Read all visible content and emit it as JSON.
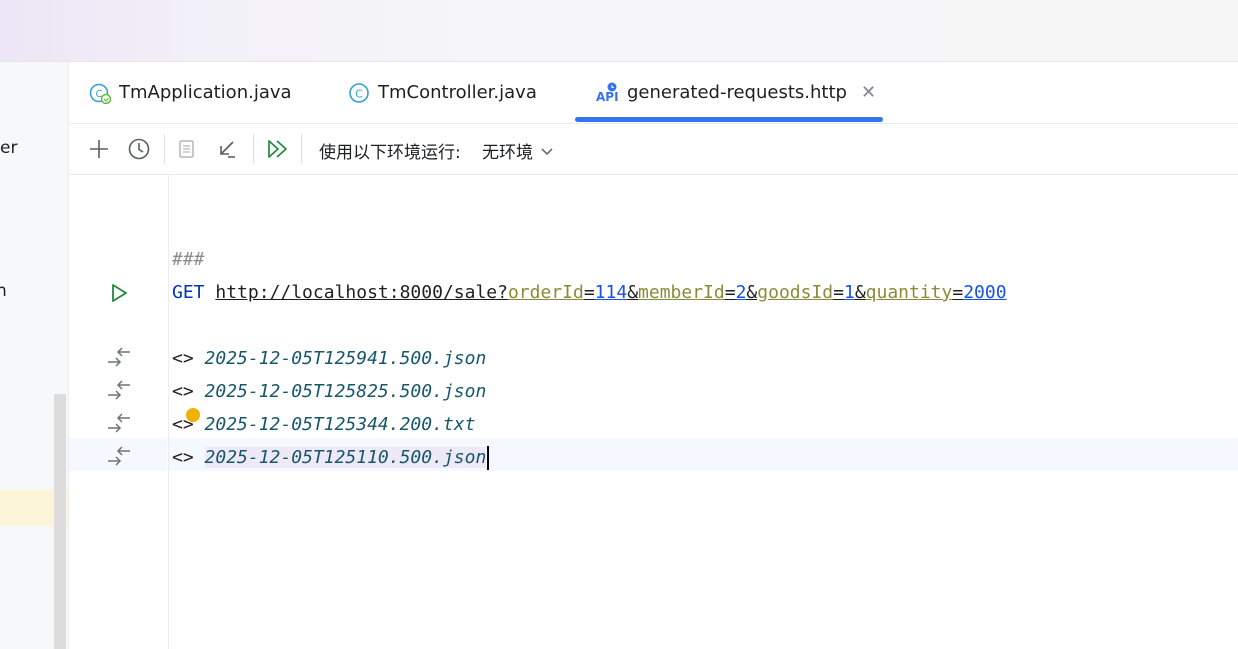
{
  "left_panel": {
    "item1": "er",
    "item2": "n"
  },
  "tabs": [
    {
      "label": "TmApplication.java",
      "icon": "spring-app-class-icon"
    },
    {
      "label": "TmController.java",
      "icon": "class-icon"
    },
    {
      "label": "generated-requests.http",
      "icon": "api-http-icon",
      "active": true
    }
  ],
  "toolbar": {
    "env_label": "使用以下环境运行:",
    "env_value": "无环境"
  },
  "editor": {
    "separator": "###",
    "method": "GET",
    "url_base": "http://localhost:8000/sale?",
    "params": [
      {
        "name": "orderId",
        "value": "114"
      },
      {
        "name": "memberId",
        "value": "2"
      },
      {
        "name": "goodsId",
        "value": "1"
      },
      {
        "name": "quantity",
        "value": "2000"
      }
    ],
    "response_prefix": "<>",
    "responses": [
      "2025-12-05T125941.500.json",
      "2025-12-05T125825.500.json",
      "2025-12-05T125344.200.txt",
      "2025-12-05T125110.500.json"
    ]
  },
  "colors": {
    "accent": "#3574f0",
    "run_green": "#208a3c",
    "keyword": "#0033b3",
    "param_name": "#8c8a38",
    "param_value": "#1750eb",
    "response_file": "#17566b",
    "bulb": "#f2b100"
  }
}
